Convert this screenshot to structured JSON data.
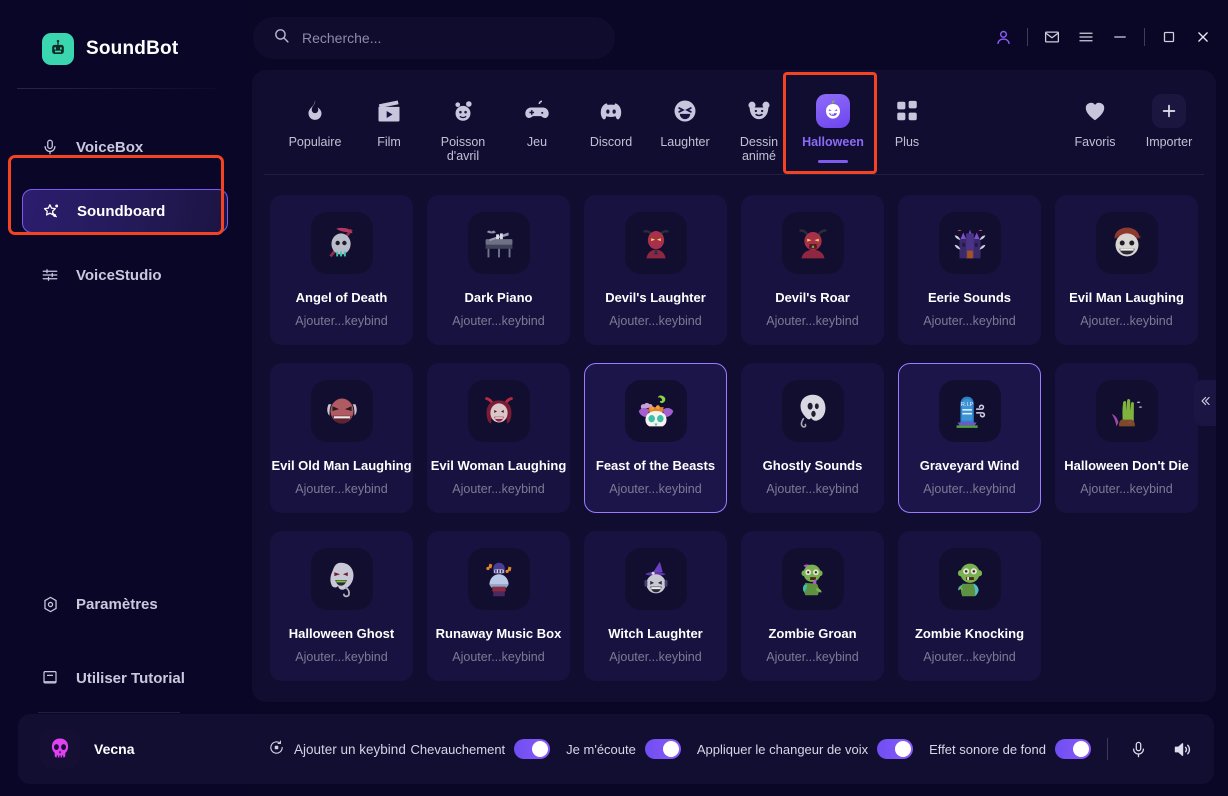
{
  "app": {
    "name": "SoundBot",
    "logo_icon": "robot-icon",
    "accent": "#7f5af0",
    "brand_logo_color": "#3ad6b0"
  },
  "search": {
    "placeholder": "Recherche...",
    "value": "",
    "icon": "search-icon"
  },
  "window_controls": [
    {
      "name": "account-icon",
      "glyph": "person"
    },
    {
      "name": "mail-icon",
      "glyph": "envelope"
    },
    {
      "name": "menu-icon",
      "glyph": "hamburger"
    },
    {
      "name": "minimize-icon",
      "glyph": "minus"
    },
    {
      "name": "maximize-icon",
      "glyph": "square"
    },
    {
      "name": "close-icon",
      "glyph": "cross"
    }
  ],
  "sidebar": {
    "items": [
      {
        "label": "VoiceBox",
        "icon": "microphone-icon",
        "active": false
      },
      {
        "label": "Soundboard",
        "icon": "magic-wand-icon",
        "active": true
      },
      {
        "label": "VoiceStudio",
        "icon": "sliders-icon",
        "active": false
      }
    ],
    "bottom_items": [
      {
        "label": "Paramètres",
        "icon": "gear-icon"
      },
      {
        "label": "Utiliser Tutorial",
        "icon": "book-icon"
      }
    ],
    "footer_icons": [
      {
        "name": "toolbox-icon"
      },
      {
        "name": "chat-smile-icon"
      }
    ],
    "highlight": {
      "target": "Soundboard",
      "color": "#f44322"
    }
  },
  "tabs": {
    "highlight_color": "#f44322",
    "highlighted_tab": "Halloween",
    "items": [
      {
        "label": "Populaire",
        "icon": "flame-icon",
        "active": false
      },
      {
        "label": "Film",
        "icon": "clapperboard-icon",
        "active": false
      },
      {
        "label": "Poisson\nd'avril",
        "icon": "clown-icon",
        "active": false
      },
      {
        "label": "Jeu",
        "icon": "gamepad-icon",
        "active": false
      },
      {
        "label": "Discord",
        "icon": "discord-icon",
        "active": false
      },
      {
        "label": "Laughter",
        "icon": "laughing-face-icon",
        "active": false
      },
      {
        "label": "Dessin animé",
        "icon": "cartoon-bear-icon",
        "active": false
      },
      {
        "label": "Halloween",
        "icon": "pumpkin-icon",
        "active": true
      },
      {
        "label": "Plus",
        "icon": "grid-squares-icon",
        "active": false
      }
    ],
    "right_items": [
      {
        "label": "Favoris",
        "icon": "heart-icon"
      },
      {
        "label": "Importer",
        "icon": "plus-icon"
      }
    ]
  },
  "sounds": {
    "keybind_placeholder": "Ajouter...keybind",
    "items": [
      {
        "title": "Angel of Death",
        "keybind": "Ajouter...keybind",
        "icon": "grim-reaper-skull-icon",
        "selected": false
      },
      {
        "title": "Dark Piano",
        "keybind": "Ajouter...keybind",
        "icon": "piano-bats-icon",
        "selected": false
      },
      {
        "title": "Devil's Laughter",
        "keybind": "Ajouter...keybind",
        "icon": "devil-horns-icon",
        "selected": false
      },
      {
        "title": "Devil's Roar",
        "keybind": "Ajouter...keybind",
        "icon": "devil-roaring-icon",
        "selected": false
      },
      {
        "title": "Eerie Sounds",
        "keybind": "Ajouter...keybind",
        "icon": "haunted-castle-icon",
        "selected": false
      },
      {
        "title": "Evil Man Laughing",
        "keybind": "Ajouter...keybind",
        "icon": "grinning-man-icon",
        "selected": false
      },
      {
        "title": "Evil Old Man Laughing",
        "keybind": "Ajouter...keybind",
        "icon": "evil-old-man-icon",
        "selected": false
      },
      {
        "title": "Evil Woman Laughing",
        "keybind": "Ajouter...keybind",
        "icon": "devil-woman-icon",
        "selected": false
      },
      {
        "title": "Feast of the Beasts",
        "keybind": "Ajouter...keybind",
        "icon": "skull-cauldron-icon",
        "selected": true
      },
      {
        "title": "Ghostly Sounds",
        "keybind": "Ajouter...keybind",
        "icon": "ghost-icon",
        "selected": false
      },
      {
        "title": "Graveyard Wind",
        "keybind": "Ajouter...keybind",
        "icon": "tombstone-wind-icon",
        "selected": true
      },
      {
        "title": "Halloween Don't Die",
        "keybind": "Ajouter...keybind",
        "icon": "zombie-hand-icon",
        "selected": false
      },
      {
        "title": "Halloween Ghost",
        "keybind": "Ajouter...keybind",
        "icon": "angry-ghost-icon",
        "selected": false
      },
      {
        "title": "Runaway Music Box",
        "keybind": "Ajouter...keybind",
        "icon": "music-box-icon",
        "selected": false
      },
      {
        "title": "Witch Laughter",
        "keybind": "Ajouter...keybind",
        "icon": "witch-icon",
        "selected": false
      },
      {
        "title": "Zombie Groan",
        "keybind": "Ajouter...keybind",
        "icon": "zombie-groan-icon",
        "selected": false
      },
      {
        "title": "Zombie Knocking",
        "keybind": "Ajouter...keybind",
        "icon": "zombie-knocking-icon",
        "selected": false
      }
    ]
  },
  "collapse": {
    "icon": "chevron-double-left-icon"
  },
  "footer": {
    "voice_name": "Vecna",
    "voice_icon": "skull-icon",
    "add_keybind": {
      "label": "Ajouter un keybind",
      "icon": "keybind-record-icon"
    },
    "toggles": [
      {
        "label": "Chevauchement",
        "on": true
      },
      {
        "label": "Je m'écoute",
        "on": true
      },
      {
        "label": "Appliquer le changeur de voix",
        "on": true
      },
      {
        "label": "Effet sonore de fond",
        "on": true
      }
    ],
    "icons": [
      {
        "name": "microphone-icon"
      },
      {
        "name": "speaker-volume-icon"
      }
    ]
  }
}
